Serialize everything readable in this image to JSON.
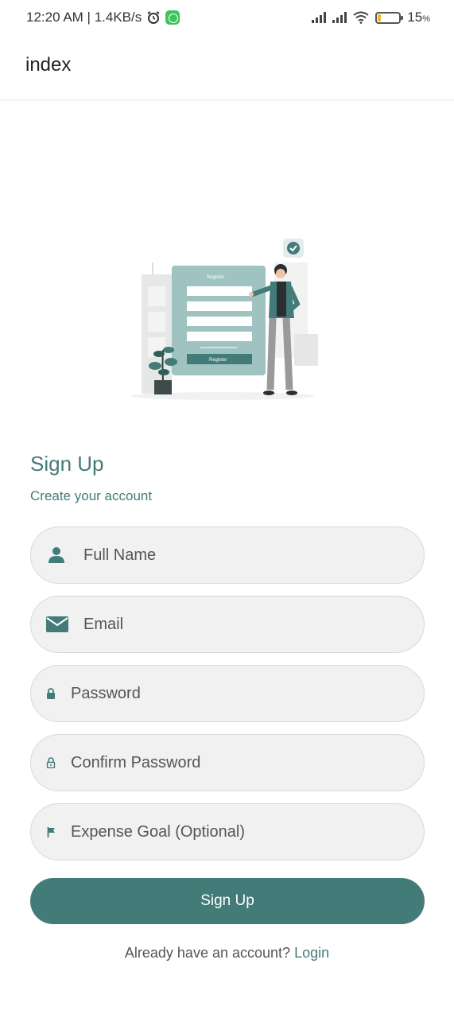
{
  "status_bar": {
    "time_info": "12:20 AM | 1.4KB/s",
    "battery": "15",
    "battery_unit": "%",
    "battery_level": 0.15,
    "icons": [
      "alarm-icon",
      "whatsapp-icon",
      "signal-icon",
      "signal-icon",
      "wifi-icon",
      "battery-icon"
    ]
  },
  "header": {
    "title": "index"
  },
  "form": {
    "title": "Sign Up",
    "subtitle": "Create your account",
    "fields": {
      "full_name": {
        "placeholder": "Full Name",
        "icon": "person-icon"
      },
      "email": {
        "placeholder": "Email",
        "icon": "mail-icon"
      },
      "password": {
        "placeholder": "Password",
        "icon": "lock-icon"
      },
      "confirm_password": {
        "placeholder": "Confirm Password",
        "icon": "lock-outline-icon"
      },
      "expense_goal": {
        "placeholder": "Expense Goal (Optional)",
        "icon": "flag-icon"
      }
    },
    "submit_label": "Sign Up",
    "login_prompt": "Already have an account?",
    "login_link": "Login"
  },
  "illustration": {
    "form_heading": "Register",
    "button_label": "Register"
  },
  "colors": {
    "accent": "#437b78",
    "field_bg": "#f1f1f1",
    "text": "#555555"
  }
}
